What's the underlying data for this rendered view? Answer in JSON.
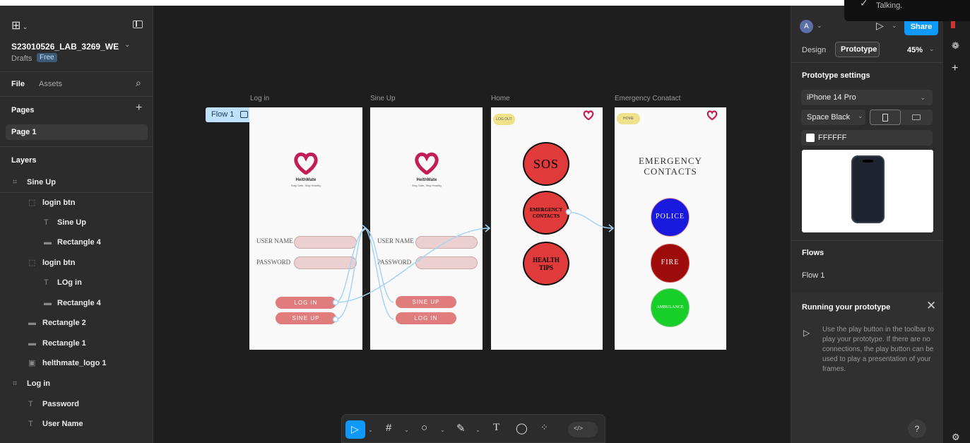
{
  "system": {
    "talking_label": "Talking."
  },
  "left_panel": {
    "file_title": "S23010526_LAB_3269_WE",
    "drafts": "Drafts",
    "plan_badge": "Free",
    "tabs": {
      "file": "File",
      "assets": "Assets"
    },
    "pages_heading": "Pages",
    "pages": [
      "Page 1"
    ],
    "layers_heading": "Layers",
    "layers": [
      {
        "label": "Sine Up",
        "icon": "frame-icon"
      },
      {
        "label": "login btn",
        "icon": "group-icon"
      },
      {
        "label": "Sine Up",
        "icon": "text-icon"
      },
      {
        "label": "Rectangle 4",
        "icon": "rectangle-icon"
      },
      {
        "label": "login btn",
        "icon": "group-icon"
      },
      {
        "label": "LOg in",
        "icon": "text-icon"
      },
      {
        "label": "Rectangle 4",
        "icon": "rectangle-icon"
      },
      {
        "label": "Rectangle 2",
        "icon": "rectangle-icon"
      },
      {
        "label": "Rectangle 1",
        "icon": "rectangle-icon"
      },
      {
        "label": "helthmate_logo 1",
        "icon": "image-icon"
      },
      {
        "label": "Log in",
        "icon": "frame-icon"
      },
      {
        "label": "Password",
        "icon": "text-icon"
      },
      {
        "label": "User Name",
        "icon": "text-icon"
      }
    ]
  },
  "canvas": {
    "flow_tag": "Flow 1",
    "frames": {
      "login": {
        "title": "Log in",
        "brand": "HelthMate",
        "tagline": "Stay Safe, Stay Healthy",
        "user_label": "USER NAME",
        "pass_label": "PASSWORD",
        "btn1": "LOG IN",
        "btn2": "SINE UP"
      },
      "signup": {
        "title": "Sine Up",
        "brand": "HelthMate",
        "tagline": "Stay Safe, Stay Healthy",
        "user_label": "USER NAME",
        "pass_label": "PASSWORD",
        "btn1": "SINE UP",
        "btn2": "LOG IN"
      },
      "home": {
        "title": "Home",
        "chip": "LOG OUT",
        "sos": "SOS",
        "emergency_line1": "EMERGENCY",
        "emergency_line2": "CONTACTS",
        "health_line1": "HEALTH",
        "health_line2": "TIPS"
      },
      "emergency": {
        "title": "Emergency Conatact",
        "chip": "HOME",
        "heading_line1": "EMERGENCY",
        "heading_line2": "CONTACTS",
        "police": "POLICE",
        "fire": "FIRE",
        "ambulance": "AMBULANCE"
      }
    }
  },
  "right_panel": {
    "avatar": "A",
    "share": "Share",
    "tabs": {
      "design": "Design",
      "prototype": "Prototype"
    },
    "zoom": "45%",
    "settings_heading": "Prototype settings",
    "device": "iPhone 14 Pro",
    "color_model": "Space Black",
    "background_hex": "FFFFFF",
    "flows_heading": "Flows",
    "flows": [
      "Flow 1"
    ],
    "running_heading": "Running your prototype",
    "running_text": "Use the play button in the toolbar to play your prototype. If there are no connections, the play button can be used to play a presentation of your frames.",
    "help": "?"
  },
  "colors": {
    "accent": "#0d99ff",
    "panel": "#2c2c2c",
    "canvas": "#1e1e1e",
    "pink_button": "#e07c7c",
    "sos_red": "#e03a3a",
    "police_blue": "#1a1adf",
    "fire_red": "#9e0b0b",
    "ambulance_green": "#18cf2a",
    "connector": "#a7d4f6"
  }
}
